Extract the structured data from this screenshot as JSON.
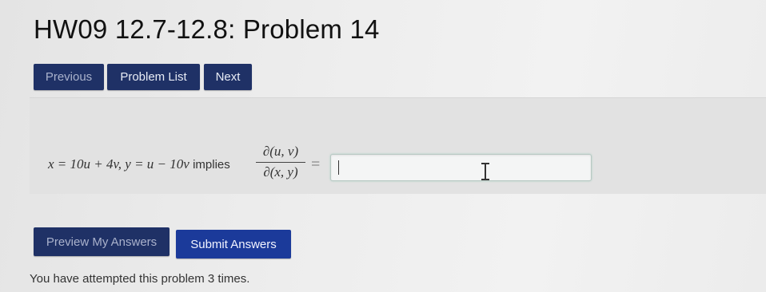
{
  "page": {
    "title": "HW09 12.7-12.8: Problem 14"
  },
  "nav": {
    "previous_label": "Previous",
    "problem_list_label": "Problem List",
    "next_label": "Next"
  },
  "problem": {
    "equation_lhs": "x = 10u + 4v, y = u − 10v",
    "implies_word": "implies",
    "fraction_numerator": "∂(u, v)",
    "fraction_denominator": "∂(x, y)",
    "equals_sign": "=",
    "answer_value": ""
  },
  "actions": {
    "preview_label": "Preview My Answers",
    "submit_label": "Submit Answers"
  },
  "status": {
    "attempts_text": "You have attempted this problem 3 times."
  }
}
